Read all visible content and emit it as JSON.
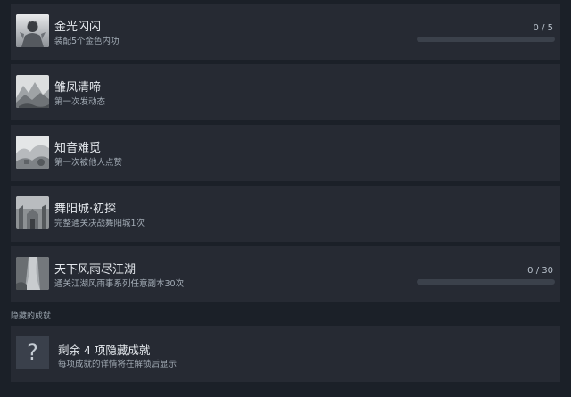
{
  "achievements": [
    {
      "name": "金光闪闪",
      "desc": "装配5个金色内功",
      "progress_text": "0 / 5",
      "progress": 0,
      "icon": "warrior-portrait-icon"
    },
    {
      "name": "雏凤清啼",
      "desc": "第一次发动态",
      "icon": "mountain-landscape-icon"
    },
    {
      "name": "知音难觅",
      "desc": "第一次被他人点赞",
      "icon": "misty-landscape-icon"
    },
    {
      "name": "舞阳城·初探",
      "desc": "完整通关决战舞阳城1次",
      "icon": "city-gate-icon"
    },
    {
      "name": "天下风雨尽江湖",
      "desc": "通关江湖风雨事系列任意副本30次",
      "progress_text": "0 / 30",
      "progress": 0,
      "icon": "river-valley-icon"
    }
  ],
  "hidden_section": {
    "title": "隐藏的成就",
    "name": "剩余 4 项隐藏成就",
    "desc": "每项成就的详情将在解锁后显示",
    "icon_glyph": "?"
  },
  "colors": {
    "background": "#1b2028",
    "card": "#262a33",
    "progress_track": "#3b414b",
    "progress_fill": "#1a9fff"
  }
}
